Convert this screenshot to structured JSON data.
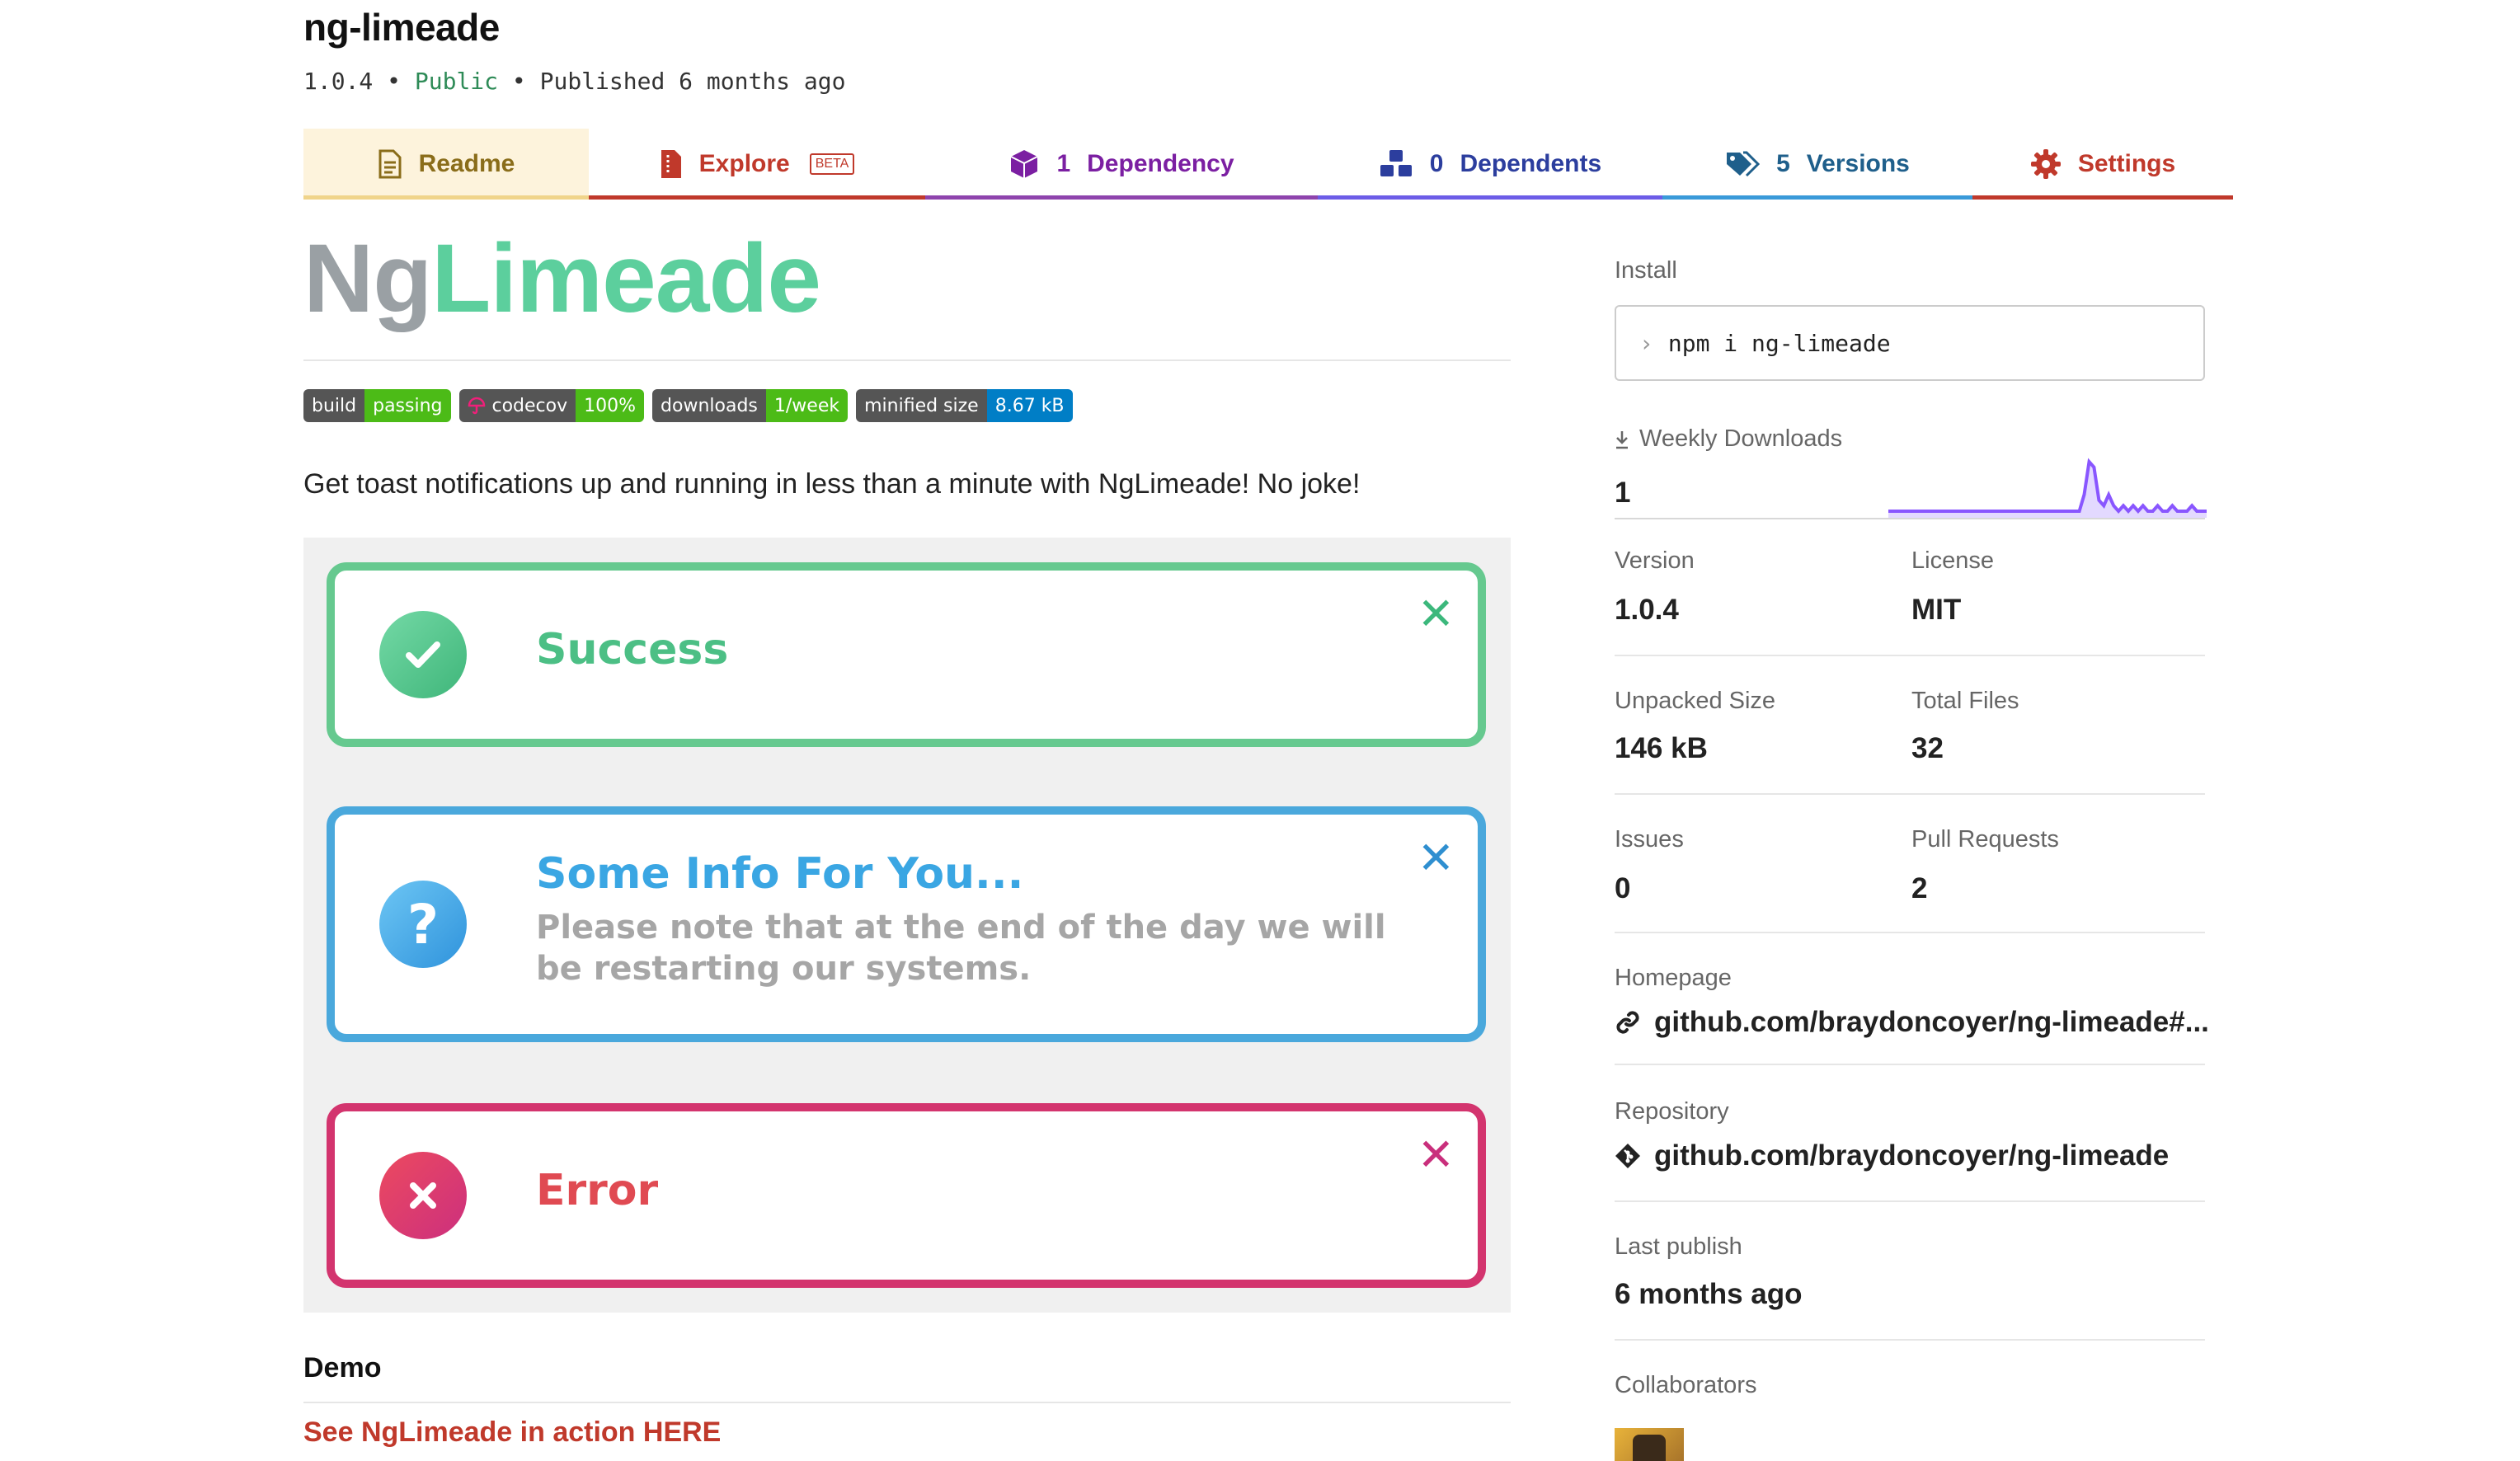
{
  "package": {
    "name": "ng-limeade",
    "version": "1.0.4",
    "visibility": "Public",
    "published": "Published 6 months ago",
    "separator": "•"
  },
  "tabs": [
    {
      "label": "Readme",
      "color": "#8a6d1a",
      "underline": "#f0d48a"
    },
    {
      "label": "Explore",
      "badge": "BETA",
      "color": "#c0392b",
      "underline": "#c0392b"
    },
    {
      "count": "1",
      "label": "Dependency",
      "color": "#7b1fa2",
      "underline": "#8e44ad"
    },
    {
      "count": "0",
      "label": "Dependents",
      "color": "#2c3e9e",
      "underline": "#6c5ce7"
    },
    {
      "count": "5",
      "label": "Versions",
      "color": "#1f5f8b",
      "underline": "#3a9ad9"
    },
    {
      "label": "Settings",
      "color": "#c0392b",
      "underline": "#c0392b"
    }
  ],
  "readme": {
    "logo_ng": "Ng",
    "logo_lime": "Limeade",
    "badges": [
      {
        "left": "build",
        "right": "passing",
        "right_color": "#4cbb17"
      },
      {
        "left": "codecov",
        "right": "100%",
        "right_color": "#4cbb17"
      },
      {
        "left": "downloads",
        "right": "1/week",
        "right_color": "#4cbb17"
      },
      {
        "left": "minified size",
        "right": "8.67 kB",
        "right_color": "#007ec6"
      }
    ],
    "tagline": "Get toast notifications up and running in less than a minute with NgLimeade! No joke!",
    "toasts": {
      "success": {
        "title": "Success"
      },
      "info": {
        "title": "Some Info For You...",
        "body": "Please note that at the end of the day we will be restarting our systems."
      },
      "error": {
        "title": "Error"
      }
    },
    "demo_heading": "Demo",
    "demo_link": "See NgLimeade in action HERE"
  },
  "sidebar": {
    "install_label": "Install",
    "install_command": "npm i ng-limeade",
    "weekly_downloads_label": "Weekly Downloads",
    "weekly_downloads_value": "1",
    "version_label": "Version",
    "version_value": "1.0.4",
    "license_label": "License",
    "license_value": "MIT",
    "unpacked_size_label": "Unpacked Size",
    "unpacked_size_value": "146 kB",
    "total_files_label": "Total Files",
    "total_files_value": "32",
    "issues_label": "Issues",
    "issues_value": "0",
    "pull_requests_label": "Pull Requests",
    "pull_requests_value": "2",
    "homepage_label": "Homepage",
    "homepage_value": "github.com/braydoncoyer/ng-limeade#...",
    "repository_label": "Repository",
    "repository_value": "github.com/braydoncoyer/ng-limeade",
    "last_publish_label": "Last publish",
    "last_publish_value": "6 months ago",
    "collaborators_label": "Collaborators"
  },
  "sparkline": {
    "color": "#8956ff",
    "fill": "#e3d9ff",
    "values": [
      0,
      0,
      0,
      0,
      0,
      0,
      0,
      0,
      0,
      0,
      0,
      0,
      0,
      0,
      0,
      0,
      0,
      0,
      0,
      0,
      0,
      0,
      0,
      0,
      0,
      0,
      0,
      0,
      0,
      0,
      0,
      0,
      0,
      0,
      0,
      0,
      0,
      0,
      0,
      0,
      3,
      9,
      8,
      2,
      1,
      3,
      1,
      0,
      1,
      0,
      1,
      0,
      1,
      0,
      0,
      1,
      0,
      0,
      1,
      0,
      0,
      0,
      1,
      0,
      0,
      0
    ]
  }
}
